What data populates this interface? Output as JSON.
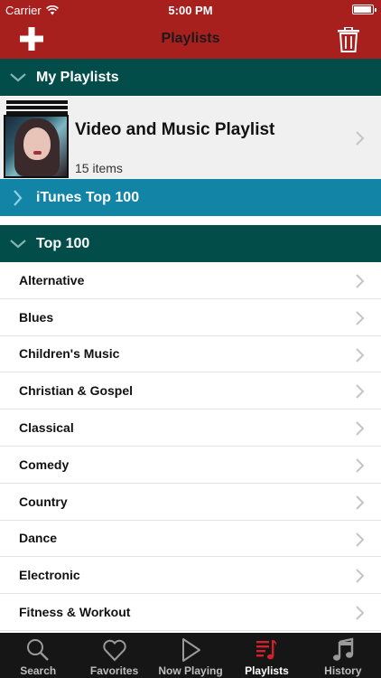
{
  "status_bar": {
    "carrier": "Carrier",
    "time": "5:00 PM"
  },
  "nav": {
    "title": "Playlists",
    "add_icon": "plus-icon",
    "trash_icon": "trash-icon",
    "accent": "#a8201e"
  },
  "sections": {
    "my_playlists": {
      "label": "My Playlists",
      "color": "#024d4a",
      "expanded": true
    },
    "itunes_top": {
      "label": "iTunes Top 100",
      "color": "#1284a6",
      "expanded": false
    },
    "top_100": {
      "label": "Top 100",
      "color": "#024d4a",
      "expanded": true
    }
  },
  "playlist": {
    "title": "Video and Music Playlist",
    "count": "15 items"
  },
  "genres": [
    "Alternative",
    "Blues",
    "Children's Music",
    "Christian & Gospel",
    "Classical",
    "Comedy",
    "Country",
    "Dance",
    "Electronic",
    "Fitness & Workout"
  ],
  "tabs": [
    {
      "label": "Search",
      "icon": "search-icon",
      "active": false
    },
    {
      "label": "Favorites",
      "icon": "heart-icon",
      "active": false
    },
    {
      "label": "Now Playing",
      "icon": "play-icon",
      "active": false
    },
    {
      "label": "Playlists",
      "icon": "playlist-icon",
      "active": true
    },
    {
      "label": "History",
      "icon": "music-note-icon",
      "active": false
    }
  ],
  "colors": {
    "active_tab_icon": "#d0202a"
  }
}
